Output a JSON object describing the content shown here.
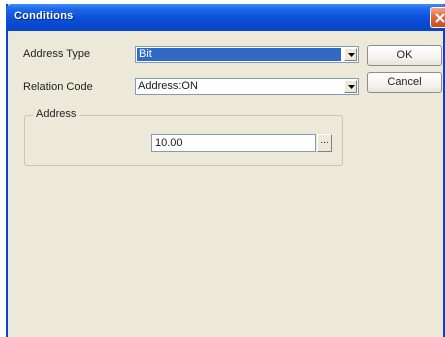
{
  "window": {
    "title": "Conditions"
  },
  "form": {
    "address_type_label": "Address Type",
    "address_type_value": "Bit",
    "relation_code_label": "Relation Code",
    "relation_code_value": "Address:ON"
  },
  "address_group": {
    "label": "Address",
    "value": "10.00",
    "browse_label": "..."
  },
  "buttons": {
    "ok": "OK",
    "cancel": "Cancel"
  },
  "icons": {
    "close": "close-icon",
    "dropdown": "chevron-down-icon"
  },
  "colors": {
    "titlebar": "#0a4fd6",
    "selection": "#316ac5",
    "dialog_bg": "#ece9d8"
  }
}
